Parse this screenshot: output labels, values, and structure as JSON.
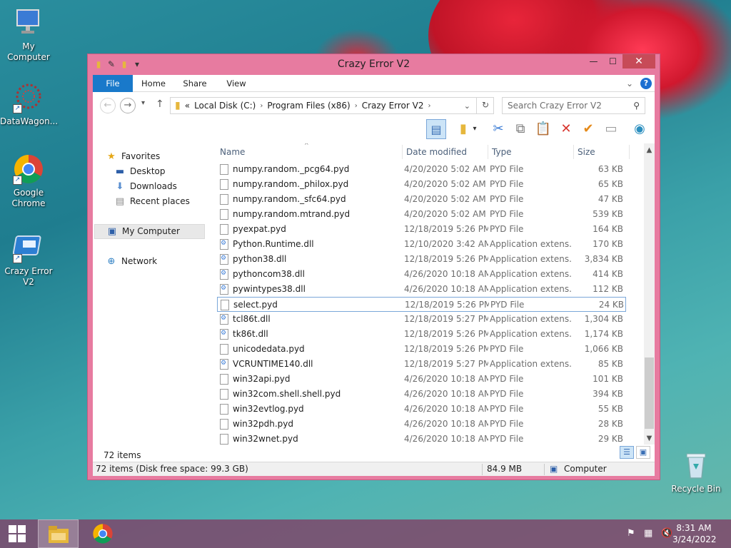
{
  "desktop": {
    "icons": [
      {
        "label": "My Computer"
      },
      {
        "label": "DataWagon..."
      },
      {
        "label": "Google Chrome"
      },
      {
        "label": "Crazy Error V2"
      },
      {
        "label": "Recycle Bin"
      }
    ]
  },
  "window": {
    "title": "Crazy Error V2",
    "tabs": {
      "file": "File",
      "home": "Home",
      "share": "Share",
      "view": "View"
    },
    "address": {
      "parts": [
        "Local Disk (C:)",
        "Program Files (x86)",
        "Crazy Error V2"
      ],
      "overflow": "«"
    },
    "search": {
      "placeholder": "Search Crazy Error V2"
    },
    "nav": {
      "favorites": "Favorites",
      "desktop": "Desktop",
      "downloads": "Downloads",
      "recent": "Recent places",
      "computer": "My Computer",
      "network": "Network"
    },
    "columns": {
      "name": "Name",
      "date": "Date modified",
      "type": "Type",
      "size": "Size"
    },
    "files": [
      {
        "name": "numpy.random._pcg64.pyd",
        "date": "4/20/2020 5:02 AM",
        "type": "PYD File",
        "size": "63 KB",
        "kind": "pyd"
      },
      {
        "name": "numpy.random._philox.pyd",
        "date": "4/20/2020 5:02 AM",
        "type": "PYD File",
        "size": "65 KB",
        "kind": "pyd"
      },
      {
        "name": "numpy.random._sfc64.pyd",
        "date": "4/20/2020 5:02 AM",
        "type": "PYD File",
        "size": "47 KB",
        "kind": "pyd"
      },
      {
        "name": "numpy.random.mtrand.pyd",
        "date": "4/20/2020 5:02 AM",
        "type": "PYD File",
        "size": "539 KB",
        "kind": "pyd"
      },
      {
        "name": "pyexpat.pyd",
        "date": "12/18/2019 5:26 PM",
        "type": "PYD File",
        "size": "164 KB",
        "kind": "pyd"
      },
      {
        "name": "Python.Runtime.dll",
        "date": "12/10/2020 3:42 AM",
        "type": "Application extens...",
        "size": "170 KB",
        "kind": "dll"
      },
      {
        "name": "python38.dll",
        "date": "12/18/2019 5:26 PM",
        "type": "Application extens...",
        "size": "3,834 KB",
        "kind": "dll"
      },
      {
        "name": "pythoncom38.dll",
        "date": "4/26/2020 10:18 AM",
        "type": "Application extens...",
        "size": "414 KB",
        "kind": "dll"
      },
      {
        "name": "pywintypes38.dll",
        "date": "4/26/2020 10:18 AM",
        "type": "Application extens...",
        "size": "112 KB",
        "kind": "dll"
      },
      {
        "name": "select.pyd",
        "date": "12/18/2019 5:26 PM",
        "type": "PYD File",
        "size": "24 KB",
        "kind": "pyd"
      },
      {
        "name": "tcl86t.dll",
        "date": "12/18/2019 5:27 PM",
        "type": "Application extens...",
        "size": "1,304 KB",
        "kind": "dll"
      },
      {
        "name": "tk86t.dll",
        "date": "12/18/2019 5:26 PM",
        "type": "Application extens...",
        "size": "1,174 KB",
        "kind": "dll"
      },
      {
        "name": "unicodedata.pyd",
        "date": "12/18/2019 5:26 PM",
        "type": "PYD File",
        "size": "1,066 KB",
        "kind": "pyd"
      },
      {
        "name": "VCRUNTIME140.dll",
        "date": "12/18/2019 5:27 PM",
        "type": "Application extens...",
        "size": "85 KB",
        "kind": "dll"
      },
      {
        "name": "win32api.pyd",
        "date": "4/26/2020 10:18 AM",
        "type": "PYD File",
        "size": "101 KB",
        "kind": "pyd"
      },
      {
        "name": "win32com.shell.shell.pyd",
        "date": "4/26/2020 10:18 AM",
        "type": "PYD File",
        "size": "394 KB",
        "kind": "pyd"
      },
      {
        "name": "win32evtlog.pyd",
        "date": "4/26/2020 10:18 AM",
        "type": "PYD File",
        "size": "55 KB",
        "kind": "pyd"
      },
      {
        "name": "win32pdh.pyd",
        "date": "4/26/2020 10:18 AM",
        "type": "PYD File",
        "size": "28 KB",
        "kind": "pyd"
      },
      {
        "name": "win32wnet.pyd",
        "date": "4/26/2020 10:18 AM",
        "type": "PYD File",
        "size": "29 KB",
        "kind": "pyd"
      }
    ],
    "selected_file": "select.pyd",
    "item_count": "72 items",
    "status": {
      "left": "72 items (Disk free space: 99.3 GB)",
      "size": "84.9 MB",
      "location": "Computer"
    }
  },
  "taskbar": {
    "clock_time": "8:31 AM",
    "clock_date": "3/24/2022"
  },
  "colors": {
    "window_frame": "#e77ba0",
    "file_tab": "#1979ca",
    "close_button": "#c74b58"
  }
}
